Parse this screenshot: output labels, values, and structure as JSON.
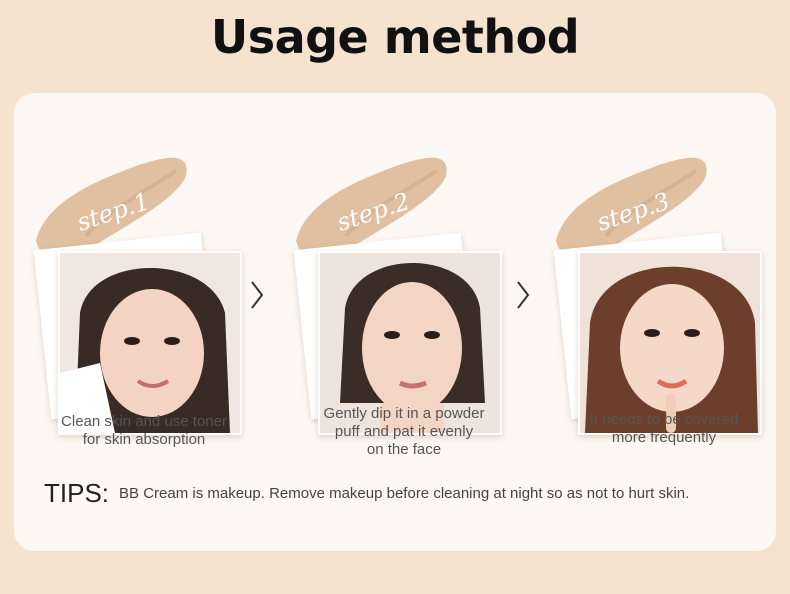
{
  "title": "Usage method",
  "steps": [
    {
      "label": "step.1",
      "caption_lines": [
        "Clean skin and use toner",
        "for skin absorption"
      ]
    },
    {
      "label": "step.2",
      "caption_lines": [
        "Gently dip it in a powder",
        "puff and pat it evenly",
        "on the face"
      ]
    },
    {
      "label": "step.3",
      "caption_lines": [
        "It needs to be covered",
        "more frequently"
      ]
    }
  ],
  "tips": {
    "label": "TIPS:",
    "text": "BB Cream is makeup. Remove makeup before cleaning at night so as not to hurt skin."
  },
  "colors": {
    "background": "#f6e3cf",
    "card": "#fdf8f3",
    "swatch": "#e0c0a0",
    "swatch_text": "#ffffff"
  },
  "icons": [
    "chevron-right-icon",
    "chevron-right-icon"
  ]
}
